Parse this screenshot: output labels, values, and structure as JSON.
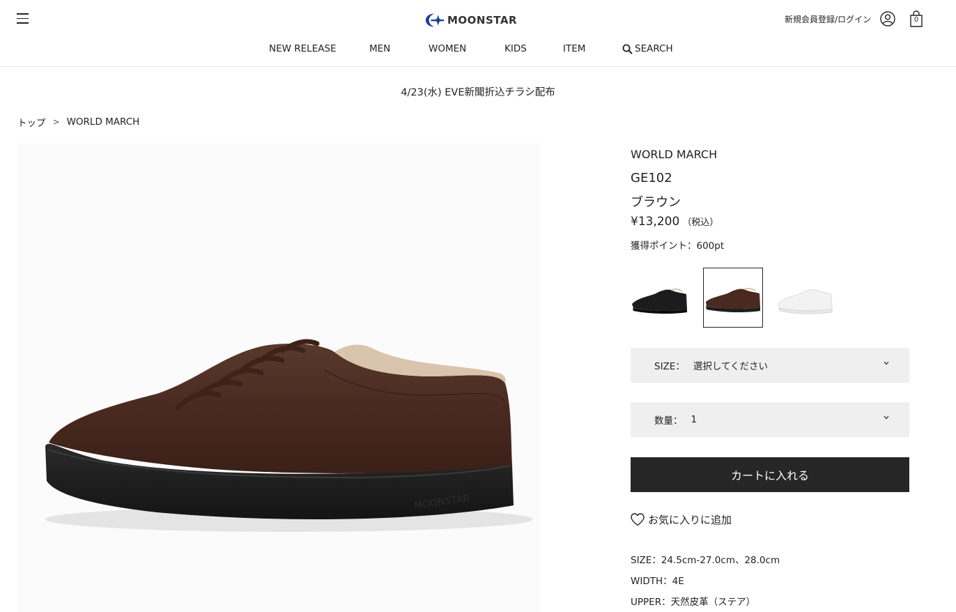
{
  "header": {
    "logo_text": "MOONSTAR",
    "login_label": "新規会員登録/ログイン",
    "cart_count": "0"
  },
  "nav": {
    "items": [
      "NEW RELEASE",
      "MEN",
      "WOMEN",
      "KIDS",
      "ITEM"
    ],
    "search_label": "SEARCH"
  },
  "announcement": "4/23(水) EVE新聞折込チラシ配布",
  "breadcrumb": {
    "home": "トップ",
    "separator": ">",
    "current": "WORLD MARCH"
  },
  "product": {
    "brand": "WORLD MARCH",
    "code": "GE102",
    "color_name": "ブラウン",
    "price": "¥13,200",
    "tax_label": "（税込）",
    "points": "獲得ポイント：600pt",
    "color_swatches": [
      {
        "color_hex": "#1c1c1c",
        "selected": false
      },
      {
        "color_hex": "#4a2a20",
        "selected": true
      },
      {
        "color_hex": "#f2f2f2",
        "selected": false
      }
    ],
    "size_select": {
      "label": "SIZE：",
      "value": "選択してください"
    },
    "qty_select": {
      "label": "数量：",
      "value": "1"
    },
    "add_to_cart_label": "カートに入れる",
    "favorite_label": "お気に入りに追加",
    "specs": [
      "SIZE：24.5cm-27.0cm、28.0cm",
      "WIDTH：4E",
      "UPPER：天然皮革（ステア）"
    ]
  },
  "colors": {
    "brand_blue": "#1b3f94",
    "button_dark": "#262626",
    "select_bg": "#efefef",
    "leather_brown": "#4a2a20",
    "sole_black": "#1e1e1e"
  },
  "icons": {
    "menu": "hamburger-icon",
    "user": "user-icon",
    "cart": "shopping-bag-icon",
    "search": "search-icon",
    "favorite": "heart-icon",
    "select": "chevron-down-icon"
  }
}
